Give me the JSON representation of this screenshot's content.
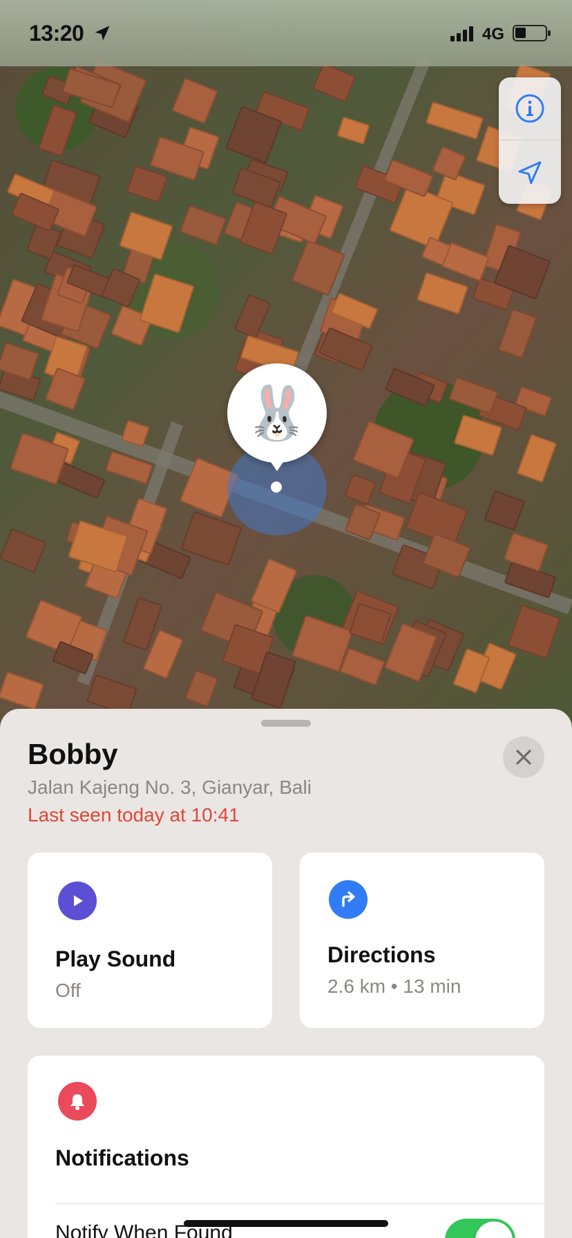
{
  "status_bar": {
    "time": "13:20",
    "network": "4G",
    "location_icon": "location-arrow-icon",
    "signal_icon": "cellular-signal-icon",
    "battery_icon": "battery-icon",
    "battery_level": 0.3
  },
  "map": {
    "buttons": [
      {
        "name": "info-button",
        "icon": "info-icon"
      },
      {
        "name": "locate-button",
        "icon": "location-arrow-icon"
      }
    ],
    "pin": {
      "emoji": "🐰",
      "icon": "rabbit-icon"
    }
  },
  "item": {
    "name": "Bobby",
    "address": "Jalan Kajeng No. 3, Gianyar, Bali",
    "last_seen": "Last seen today at 10:41",
    "close_icon": "close-icon"
  },
  "actions": {
    "play_sound": {
      "title": "Play Sound",
      "subtitle": "Off",
      "icon": "play-icon",
      "color": "#5b4fd3"
    },
    "directions": {
      "title": "Directions",
      "subtitle": "2.6 km • 13 min",
      "icon": "turn-right-arrow-icon",
      "color": "#2f7cf6"
    }
  },
  "notifications": {
    "title": "Notifications",
    "icon": "bell-icon",
    "color": "#ea4a5a",
    "notify_when_found": {
      "label": "Notify When Found",
      "enabled": true
    },
    "toggle_color": "#34c759"
  },
  "colors": {
    "accent_blue": "#2f7cf6",
    "alert_red": "#e0463a",
    "sheet_bg": "#e9e6e3"
  }
}
